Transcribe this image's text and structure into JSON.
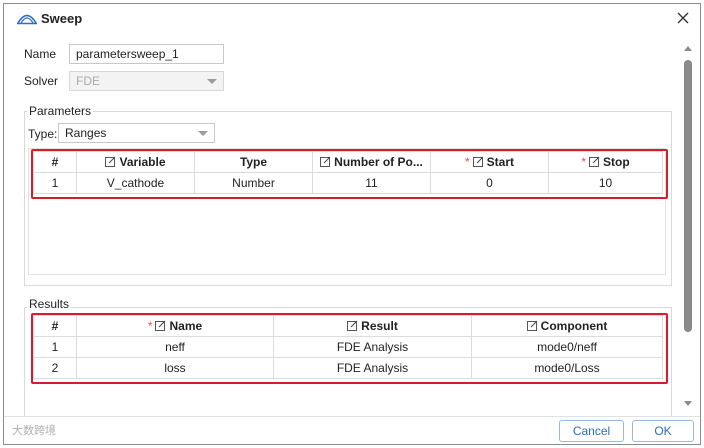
{
  "window": {
    "title": "Sweep",
    "icon": "sweep-arc-icon",
    "close_icon": "close-icon"
  },
  "form": {
    "name_label": "Name",
    "name_value": "parametersweep_1",
    "solver_label": "Solver",
    "solver_value": "FDE"
  },
  "parameters": {
    "group_title": "Parameters",
    "type_label": "Type:",
    "type_value": "Ranges",
    "columns": [
      "#",
      "Variable",
      "Type",
      "Number of Po...",
      "Start",
      "Stop"
    ],
    "rows": [
      {
        "index": "1",
        "variable": "V_cathode",
        "type": "Number",
        "points": "11",
        "start": "0",
        "stop": "10"
      }
    ]
  },
  "results": {
    "group_title": "Results",
    "columns": [
      "#",
      "Name",
      "Result",
      "Component"
    ],
    "rows": [
      {
        "index": "1",
        "name": "neff",
        "result": "FDE Analysis",
        "component": "mode0/neff"
      },
      {
        "index": "2",
        "name": "loss",
        "result": "FDE Analysis",
        "component": "mode0/Loss"
      }
    ]
  },
  "buttons": {
    "cancel": "Cancel",
    "ok": "OK"
  },
  "watermark": "大数跨境",
  "colors": {
    "highlight": "#d91c2b",
    "accent": "#2b6cc4",
    "required": "#e05050"
  }
}
